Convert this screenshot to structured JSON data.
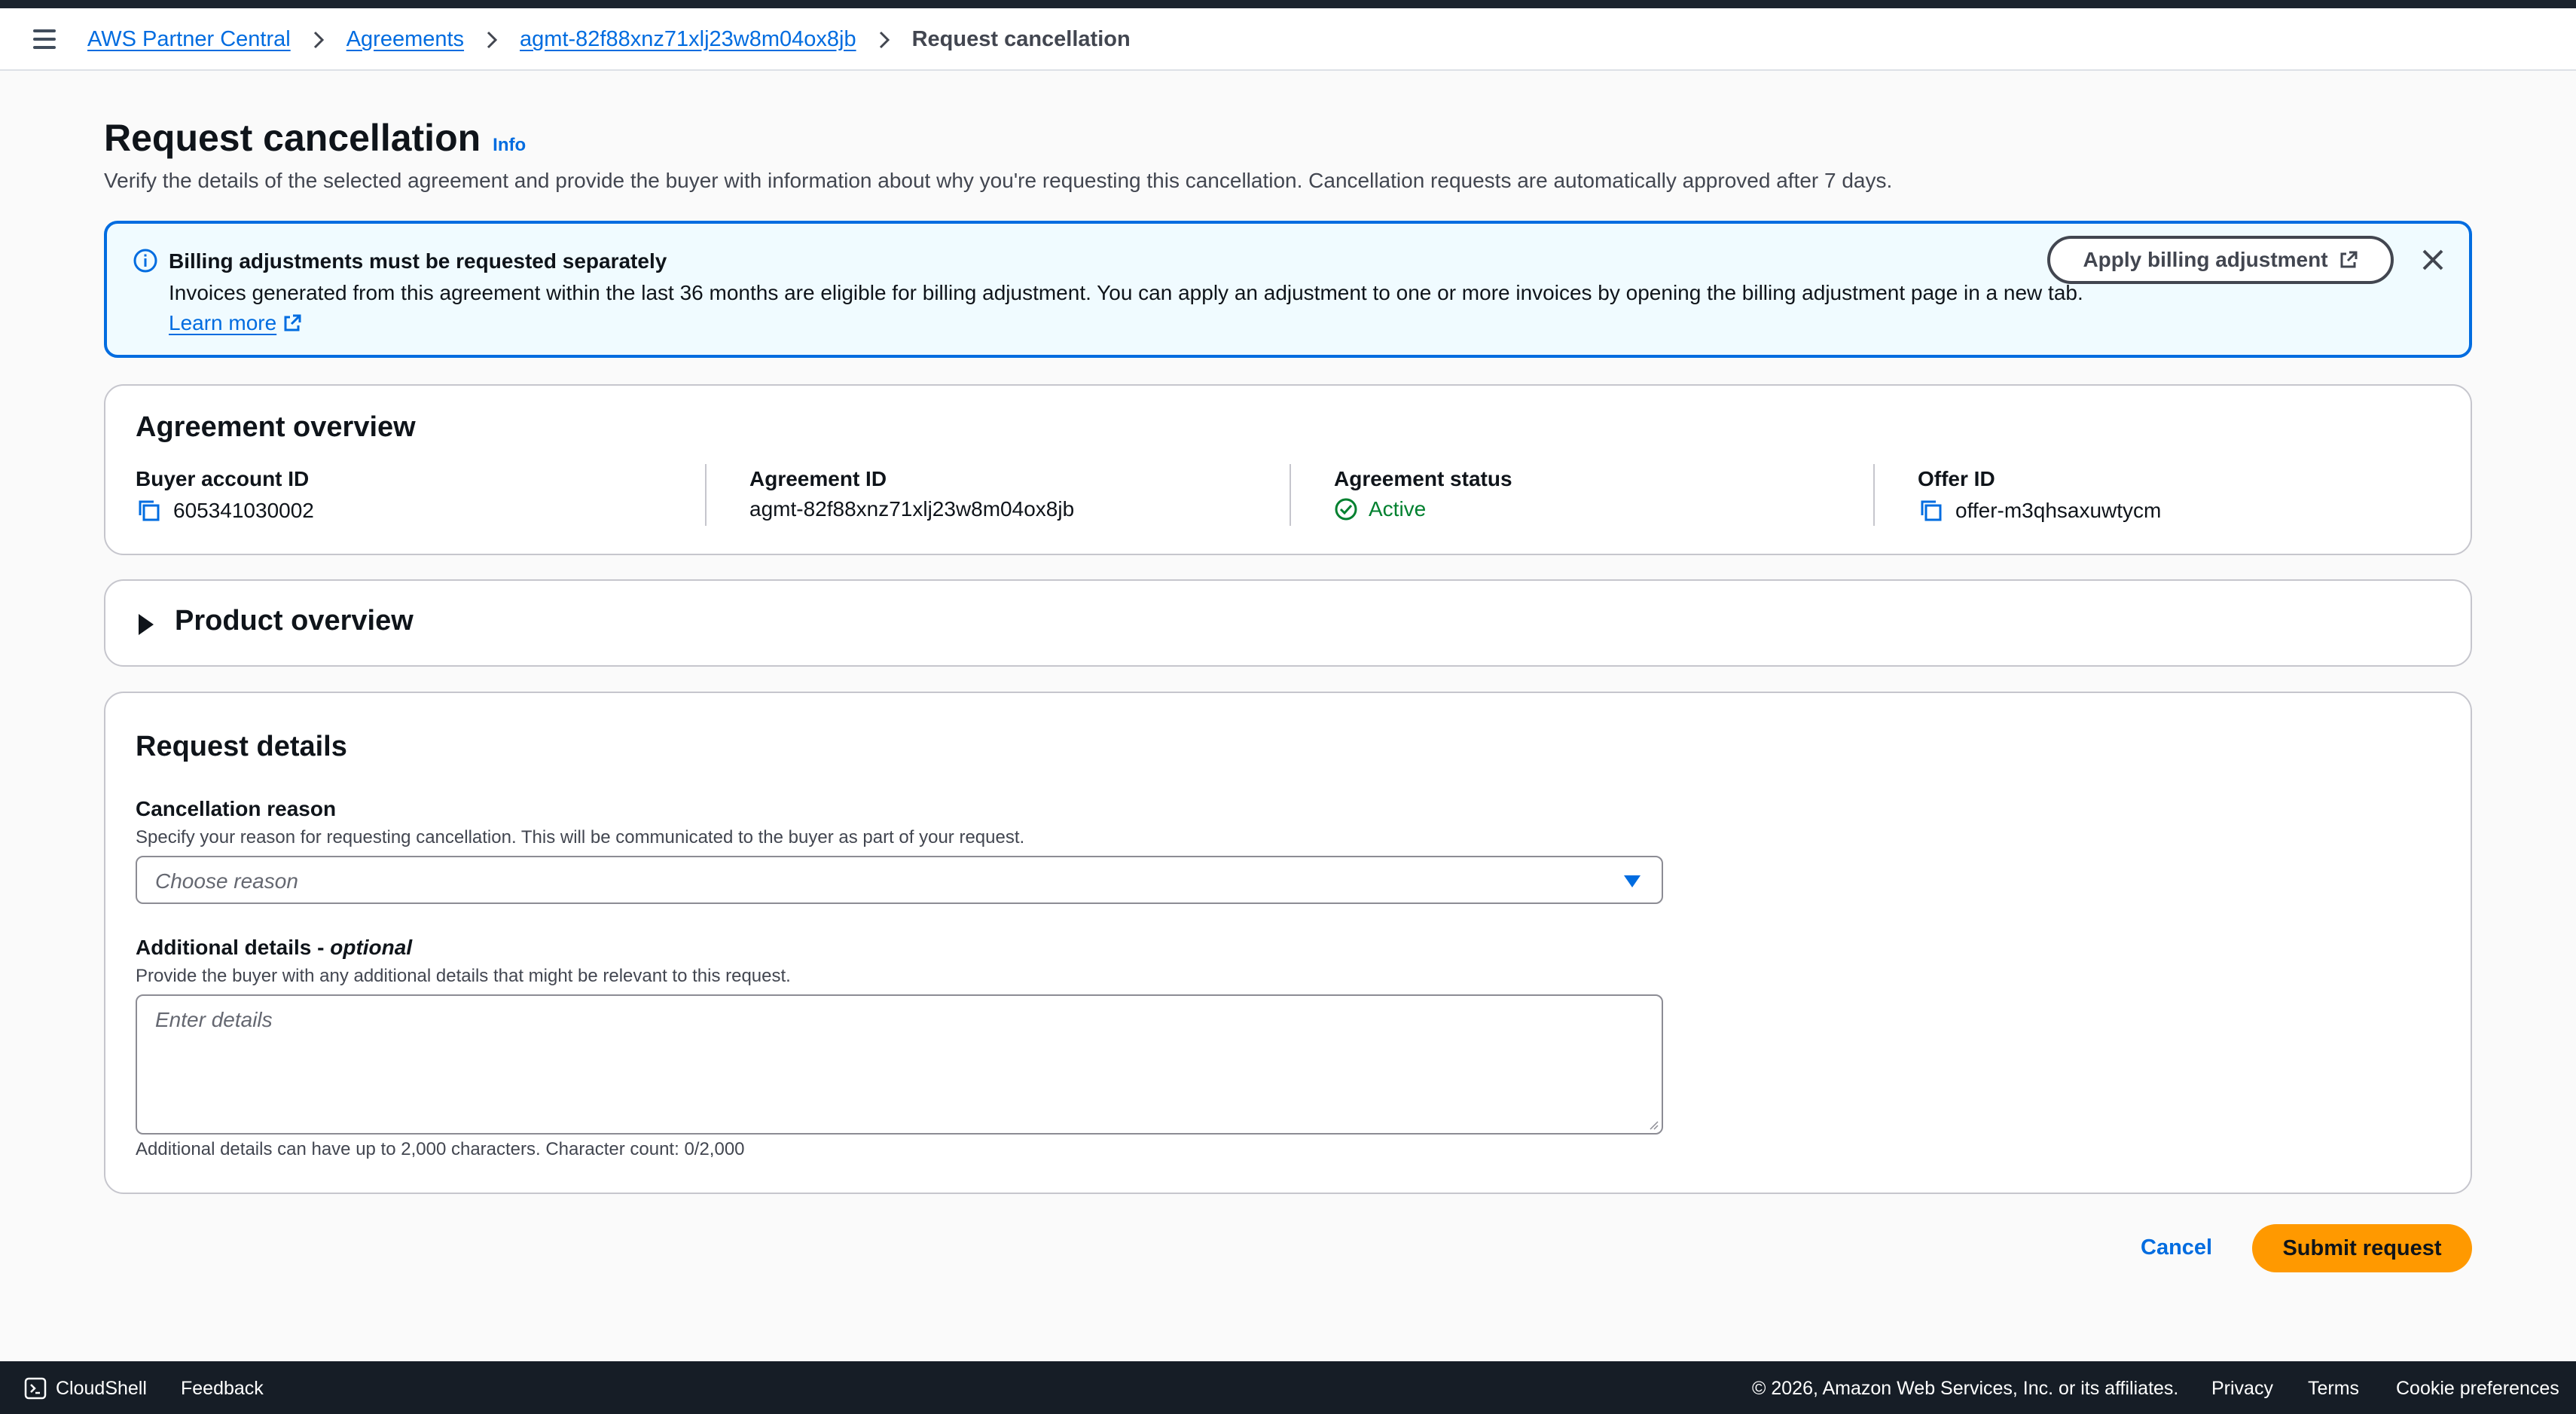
{
  "breadcrumb": {
    "items": [
      "AWS Partner Central",
      "Agreements",
      "agmt-82f88xnz71xlj23w8m04ox8jb"
    ],
    "current": "Request cancellation"
  },
  "page": {
    "title": "Request cancellation",
    "info_link": "Info",
    "description": "Verify the details of the selected agreement and provide the buyer with information about why you're requesting this cancellation. Cancellation requests are automatically approved after 7 days."
  },
  "alert": {
    "title": "Billing adjustments must be requested separately",
    "body": "Invoices generated from this agreement within the last 36 months are eligible for billing adjustment. You can apply an adjustment to one or more invoices by opening the billing adjustment page in a new tab.",
    "learn_more": "Learn more",
    "button_label": "Apply billing adjustment",
    "info_color": "#006ce0"
  },
  "overview": {
    "title": "Agreement overview",
    "buyer_account_label": "Buyer account ID",
    "buyer_account_value": "605341030002",
    "agreement_id_label": "Agreement ID",
    "agreement_id_value": "agmt-82f88xnz71xlj23w8m04ox8jb",
    "status_label": "Agreement status",
    "status_value": "Active",
    "status_color": "#00802f",
    "offer_id_label": "Offer ID",
    "offer_id_value": "offer-m3qhsaxuwtycm"
  },
  "product": {
    "title": "Product overview",
    "expanded": false
  },
  "request": {
    "title": "Request details",
    "reason_label": "Cancellation reason",
    "reason_desc": "Specify your reason for requesting cancellation. This will be communicated to the buyer as part of your request.",
    "reason_placeholder": "Choose reason",
    "details_label": "Additional details - ",
    "details_optional": "optional",
    "details_desc": "Provide the buyer with any additional details that might be relevant to this request.",
    "details_placeholder": "Enter details",
    "char_count_text": "Additional details can have up to 2,000 characters. Character count: 0/2,000"
  },
  "actions": {
    "cancel": "Cancel",
    "submit": "Submit request",
    "submit_color": "#ff9900"
  },
  "footer": {
    "cloudshell": "CloudShell",
    "feedback": "Feedback",
    "copyright": "© 2026, Amazon Web Services, Inc. or its affiliates.",
    "privacy": "Privacy",
    "terms": "Terms",
    "cookies": "Cookie preferences"
  }
}
